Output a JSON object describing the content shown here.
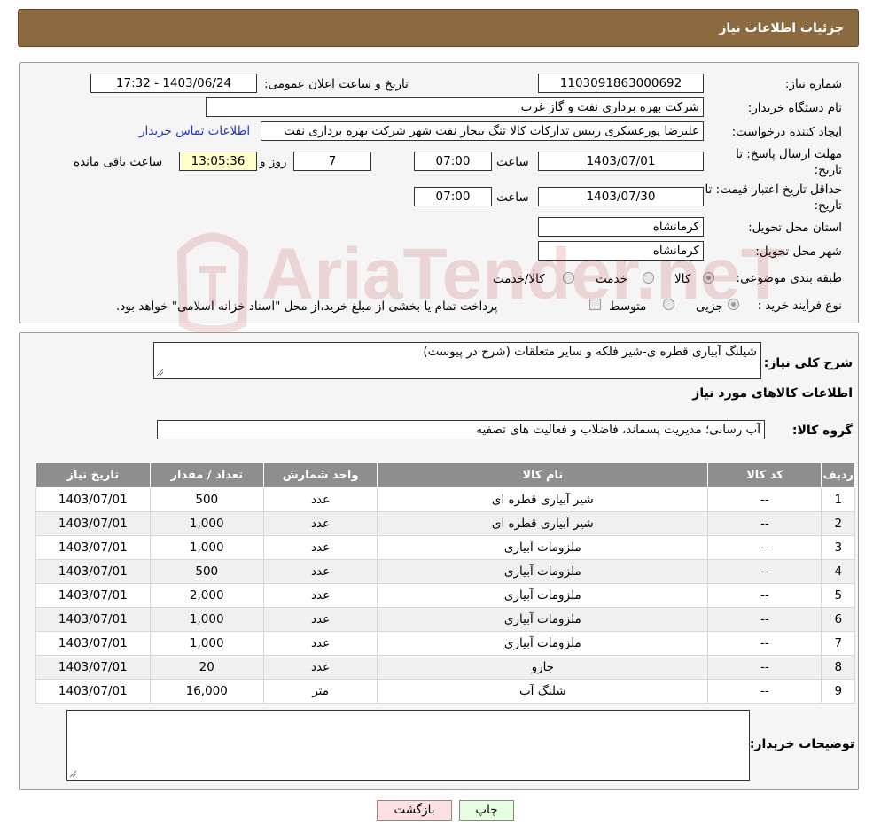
{
  "header": {
    "title": "جزئیات اطلاعات نیاز"
  },
  "details": {
    "need_number_label": "شماره نیاز:",
    "need_number": "1103091863000692",
    "announce_label": "تاریخ و ساعت اعلان عمومی:",
    "announce_value": "1403/06/24 - 17:32",
    "buyer_org_label": "نام دستگاه خریدار:",
    "buyer_org": "شرکت بهره برداری نفت و گاز غرب",
    "requester_label": "ایجاد کننده درخواست:",
    "requester": "علیرضا پورعسکری رییس تدارکات کالا تنگ بیجار نفت شهر شرکت بهره برداری نفت",
    "contact_link": "اطلاعات تماس خریدار",
    "deadline_label_1": "مهلت ارسال پاسخ: تا",
    "deadline_label_2": "تاریخ:",
    "deadline_date": "1403/07/01",
    "time_label": "ساعت",
    "deadline_time": "07:00",
    "days_value": "7",
    "days_label": "روز و",
    "remaining_time": "13:05:36",
    "remaining_label": "ساعت باقی مانده",
    "validity_label_1": "حداقل تاریخ اعتبار قیمت: تا",
    "validity_label_2": "تاریخ:",
    "validity_date": "1403/07/30",
    "validity_time": "07:00",
    "province_label": "استان محل تحویل:",
    "province": "کرمانشاه",
    "city_label": "شهر محل تحویل:",
    "city": "کرمانشاه",
    "category_label": "طبقه بندی موضوعی:",
    "category_options": [
      "کالا",
      "خدمت",
      "کالا/خدمت"
    ],
    "process_label": "نوع فرآیند خرید :",
    "process_options": [
      "جزیی",
      "متوسط"
    ],
    "process_note": "پرداخت تمام یا بخشی از مبلغ خرید،از محل \"اسناد خزانه اسلامی\" خواهد بود."
  },
  "summary": {
    "desc_label": "شرح کلی نیاز:",
    "desc_value": "شیلنگ آبیاری قطره ی-شیر فلکه و سایر متعلقات (شرح در پیوست)",
    "items_title": "اطلاعات کالاهای مورد نیاز",
    "group_label": "گروه کالا:",
    "group_value": "آب رسانی؛ مدیریت پسماند، فاضلاب و فعالیت های تصفیه",
    "columns": [
      "ردیف",
      "کد کالا",
      "نام کالا",
      "واحد شمارش",
      "تعداد / مقدار",
      "تاریخ نیاز"
    ],
    "rows": [
      [
        "1",
        "--",
        "شیر آبیاری قطره ای",
        "عدد",
        "500",
        "1403/07/01"
      ],
      [
        "2",
        "--",
        "شیر آبیاری قطره ای",
        "عدد",
        "1,000",
        "1403/07/01"
      ],
      [
        "3",
        "--",
        "ملزومات آبیاری",
        "عدد",
        "1,000",
        "1403/07/01"
      ],
      [
        "4",
        "--",
        "ملزومات آبیاری",
        "عدد",
        "500",
        "1403/07/01"
      ],
      [
        "5",
        "--",
        "ملزومات آبیاری",
        "عدد",
        "2,000",
        "1403/07/01"
      ],
      [
        "6",
        "--",
        "ملزومات آبیاری",
        "عدد",
        "1,000",
        "1403/07/01"
      ],
      [
        "7",
        "--",
        "ملزومات آبیاری",
        "عدد",
        "1,000",
        "1403/07/01"
      ],
      [
        "8",
        "--",
        "جارو",
        "عدد",
        "20",
        "1403/07/01"
      ],
      [
        "9",
        "--",
        "شلنگ آب",
        "متر",
        "16,000",
        "1403/07/01"
      ]
    ],
    "buyer_notes_label": "توضیحات خریدار:",
    "buyer_notes_value": ""
  },
  "buttons": {
    "print": "چاپ",
    "back": "بازگشت"
  },
  "watermark": {
    "text": "AriaTender.neT"
  },
  "colors": {
    "header": "#8b6a3f",
    "table_header": "#8e8e8e",
    "back_button": "#ffe0e0",
    "print_button": "#e6ffe0"
  }
}
